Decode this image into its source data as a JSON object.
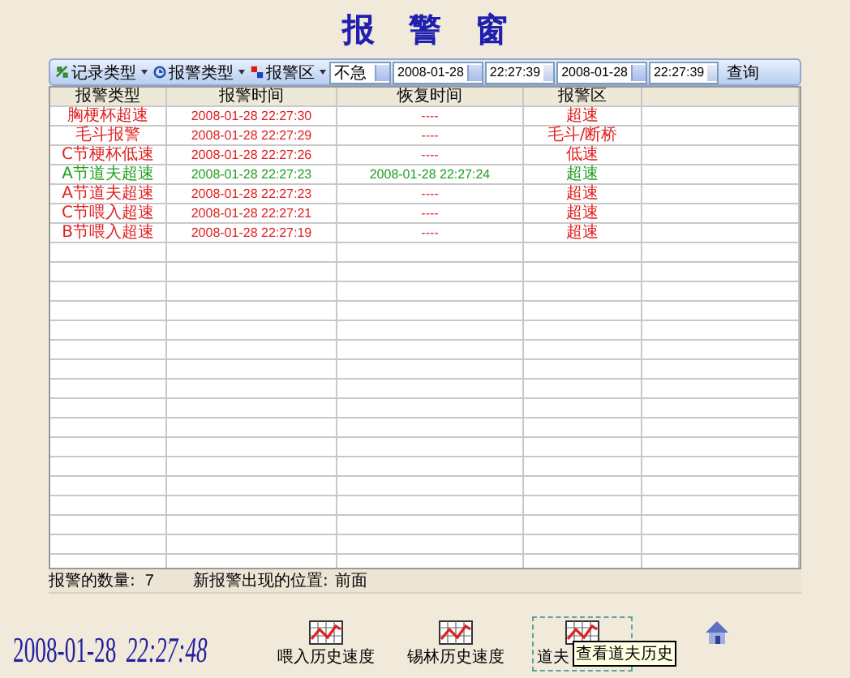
{
  "window": {
    "title": "报 警 窗"
  },
  "toolbar": {
    "filters": [
      {
        "label": "记录类型",
        "kind": "record"
      },
      {
        "label": "报警类型",
        "kind": "alarm"
      },
      {
        "label": "报警区",
        "kind": "zone"
      }
    ],
    "combo": "不急",
    "start_date": "2008-01-28",
    "start_time": "22:27:39",
    "end_date": "2008-01-28",
    "end_time": "22:27:39",
    "query": "查询"
  },
  "table": {
    "columns": [
      "报警类型",
      "报警时间",
      "恢复时间",
      "报警区"
    ],
    "rows": [
      {
        "type": "胸梗杯超速",
        "time": "2008-01-28 22:27:30",
        "recovered": "----",
        "zone": "超速",
        "color": "#e02020"
      },
      {
        "type": "毛斗报警",
        "time": "2008-01-28 22:27:29",
        "recovered": "----",
        "zone": "毛斗/断桥",
        "color": "#e02020"
      },
      {
        "type": "C节梗杯低速",
        "time": "2008-01-28 22:27:26",
        "recovered": "----",
        "zone": "低速",
        "color": "#e02020"
      },
      {
        "type": "A节道夫超速",
        "time": "2008-01-28 22:27:23",
        "recovered": "2008-01-28 22:27:24",
        "zone": "超速",
        "color": "#20a020"
      },
      {
        "type": "A节道夫超速",
        "time": "2008-01-28 22:27:23",
        "recovered": "----",
        "zone": "超速",
        "color": "#e02020"
      },
      {
        "type": "C节喂入超速",
        "time": "2008-01-28 22:27:21",
        "recovered": "----",
        "zone": "超速",
        "color": "#e02020"
      },
      {
        "type": "B节喂入超速",
        "time": "2008-01-28 22:27:19",
        "recovered": "----",
        "zone": "超速",
        "color": "#e02020"
      }
    ]
  },
  "status_bar": {
    "count_label": "报警的数量:",
    "count": "7",
    "position_label": "新报警出现的位置:",
    "position": "前面"
  },
  "clock": {
    "date": "2008-01-28",
    "time": "22:27:48"
  },
  "buttons": [
    {
      "label": "喂入历史速度",
      "focused": false
    },
    {
      "label": "锡林历史速度",
      "focused": false
    },
    {
      "label": "道夫",
      "focused": true,
      "tooltip": "查看道夫历史"
    }
  ]
}
